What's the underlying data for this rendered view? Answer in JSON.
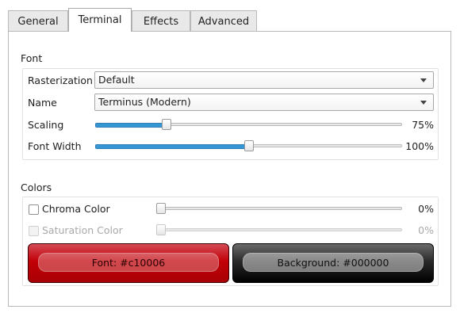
{
  "tabs": [
    {
      "label": "General"
    },
    {
      "label": "Terminal"
    },
    {
      "label": "Effects"
    },
    {
      "label": "Advanced"
    }
  ],
  "active_tab": "Terminal",
  "font_section": {
    "title": "Font",
    "rasterization": {
      "label": "Rasterization",
      "value": "Default"
    },
    "name": {
      "label": "Name",
      "value": "Terminus (Modern)"
    },
    "scaling": {
      "label": "Scaling",
      "value_text": "75%",
      "level": 0.23
    },
    "font_width": {
      "label": "Font Width",
      "value_text": "100%",
      "level": 0.5
    }
  },
  "colors_section": {
    "title": "Colors",
    "chroma": {
      "label": "Chroma Color",
      "checked": false,
      "enabled": true,
      "value_text": "0%",
      "level": 0
    },
    "saturation": {
      "label": "Saturation Color",
      "checked": false,
      "enabled": false,
      "value_text": "0%",
      "level": 0
    },
    "font_button": {
      "label": "Font:  #c10006",
      "color": "#c10006"
    },
    "background_button": {
      "label": "Background:  #000000",
      "color": "#000000"
    }
  },
  "accent_color": "#3596d6"
}
